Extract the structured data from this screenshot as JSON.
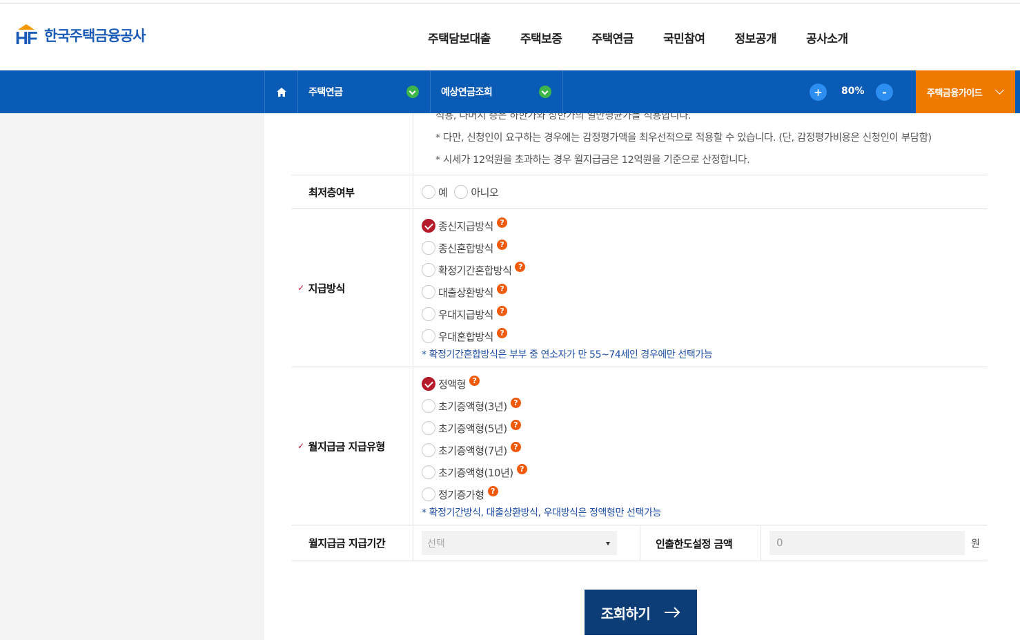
{
  "header": {
    "logo_text": "한국주택금융공사",
    "nav": [
      "주택담보대출",
      "주택보증",
      "주택연금",
      "국민참여",
      "정보공개",
      "공사소개"
    ]
  },
  "locbar": {
    "level1": "주택연금",
    "level2": "예상연금조회",
    "zoom_in": "+",
    "zoom_level": "80%",
    "zoom_out": "-",
    "guide": "주택금융가이드"
  },
  "notes": [
    "적용, 나머지 층은 하한가와 상한가의 일반평균가를 적용합니다.",
    "* 다만, 신청인이 요구하는 경우에는 감정평가액을 최우선적으로 적용할 수 있습니다. (단, 감정평가비용은 신청인이 부담함)",
    "* 시세가 12억원을 초과하는 경우 월지급금은 12억원을 기준으로 산정합니다."
  ],
  "lowest_floor": {
    "label": "최저층여부",
    "options": [
      "예",
      "아니오"
    ]
  },
  "payment_method": {
    "label": "지급방식",
    "options": [
      "종신지급방식",
      "종신혼합방식",
      "확정기간혼합방식",
      "대출상환방식",
      "우대지급방식",
      "우대혼합방식"
    ],
    "selected": "종신지급방식",
    "hint": "* 확정기간혼합방식은 부부 중 연소자가 만 55~74세인 경우에만 선택가능"
  },
  "payment_type": {
    "label": "월지급금 지급유형",
    "options": [
      "정액형",
      "초기증액형(3년)",
      "초기증액형(5년)",
      "초기증액형(7년)",
      "초기증액형(10년)",
      "정기증가형"
    ],
    "selected": "정액형",
    "hint": "* 확정기간방식, 대출상환방식, 우대방식은 정액형만 선택가능"
  },
  "period": {
    "label": "월지급금 지급기간",
    "select_value": "선택",
    "limit_label": "인출한도설정 금액",
    "limit_value": "0",
    "unit": "원"
  },
  "search_button": "조회하기",
  "help_glyph": "?"
}
